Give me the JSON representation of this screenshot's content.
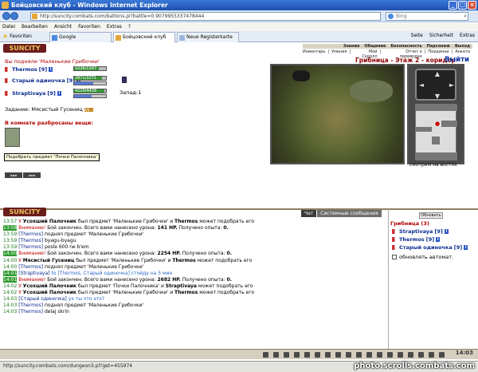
{
  "window": {
    "title": "Бойцовский клуб - Windows Internet Explorer"
  },
  "browser": {
    "url": "http://suncity.combats.com/battons.pl?battle=0.9079955337478444",
    "search_placeholder": "Bing",
    "menu": [
      "Datei",
      "Bearbeiten",
      "Ansicht",
      "Favoriten",
      "Extras",
      "?"
    ],
    "favorites_label": "Favoriten",
    "tabs": [
      {
        "label": "Google"
      },
      {
        "label": "Бойцовский клуб"
      },
      {
        "label": "Neue Registerkarte"
      }
    ],
    "tools": [
      "Seite",
      "Sicherheit",
      "Extras"
    ],
    "status_url": "http://suncity.combats.com/dungeon3.pl?get=455974"
  },
  "game": {
    "logo": "SUNCITY",
    "topnav_row1": [
      "Знания",
      "Общение",
      "Безопасность",
      "Персонаж",
      "Выход"
    ],
    "topnav_row2": [
      "Инвентарь",
      "Умения",
      "Мой Скролл",
      "Отчет о переводах",
      "Поединки",
      "Анкета"
    ],
    "location": "Грибница - Этаж 2 - коридор",
    "exit_label": "Выйти",
    "notice": "Вы подняли 'Маленькие Грибочки'",
    "players": [
      {
        "name": "Thermos",
        "level": "[9]",
        "hp": "1036/1347",
        "hp_frac": 0.77
      },
      {
        "name": "Старый одиночка",
        "level": "[9]",
        "hp": "2871/3271",
        "hp_frac": 0.88
      },
      {
        "name": "Straptivaya",
        "level": "[9]",
        "hp": "4229/4438",
        "hp_frac": 0.95
      }
    ],
    "direction": "Запад-1",
    "task_label": "Задание: Мясистый Гусениц",
    "task_progress": "3/6",
    "scattered_title": "В комнате разбросаны вещи:",
    "tooltip": "Подобрать предмет 'Почки Палочника'",
    "facing": "смотрим на восток",
    "chat_tabs": [
      "Чат",
      "Системные сообщения"
    ],
    "refresh_label": "Обновить",
    "room_title": "Грибница (3)",
    "room_players": [
      {
        "name": "Straptivaya",
        "level": "[9]"
      },
      {
        "name": "Thermos",
        "level": "[9]"
      },
      {
        "name": "Старый одиночка",
        "level": "[9]"
      }
    ],
    "auto_refresh_label": "обновлять автомат.",
    "clock": "14:03",
    "chat": [
      {
        "t": "13:57",
        "hl": false,
        "parts": [
          {
            "c": "warn",
            "x": "У "
          },
          {
            "c": "bold",
            "x": "Усохший Палочник"
          },
          {
            "c": "",
            "x": " был предмет 'Маленькие Грибочки' и "
          },
          {
            "c": "bold",
            "x": "Thermos"
          },
          {
            "c": "",
            "x": " может подобрать его"
          }
        ]
      },
      {
        "t": "13:58",
        "hl": true,
        "parts": [
          {
            "c": "warn",
            "x": "Внимание!"
          },
          {
            "c": "",
            "x": " Бой закончен. Всего вами нанесено урона: "
          },
          {
            "c": "bold",
            "x": "141 HP."
          },
          {
            "c": "",
            "x": " Получено опыта: "
          },
          {
            "c": "bold",
            "x": "0."
          }
        ]
      },
      {
        "t": "13:59",
        "hl": false,
        "parts": [
          {
            "c": "nm",
            "x": "[Thermos]"
          },
          {
            "c": "",
            "x": " поднял предмет 'Маленькие Грибочки'"
          }
        ]
      },
      {
        "t": "13:59",
        "hl": false,
        "parts": [
          {
            "c": "nm",
            "x": "[Thermos]"
          },
          {
            "c": "",
            "x": " byagu-byagu"
          }
        ]
      },
      {
        "t": "13:59",
        "hl": false,
        "parts": [
          {
            "c": "nm",
            "x": "[Thermos]"
          },
          {
            "c": "",
            "x": " posle 600 ne b'em"
          }
        ]
      },
      {
        "t": "14:00",
        "hl": true,
        "parts": [
          {
            "c": "warn",
            "x": "Внимание!"
          },
          {
            "c": "",
            "x": " Бой закончен. Всего вами нанесено урона: "
          },
          {
            "c": "bold",
            "x": "2254 HP."
          },
          {
            "c": "",
            "x": " Получено опыта: "
          },
          {
            "c": "bold",
            "x": "0."
          }
        ]
      },
      {
        "t": "14:00",
        "hl": false,
        "parts": [
          {
            "c": "warn",
            "x": "У "
          },
          {
            "c": "bold",
            "x": "Мясистый Гусениц"
          },
          {
            "c": "",
            "x": " был предмет 'Маленькие Грибочки' и "
          },
          {
            "c": "bold",
            "x": "Thermos"
          },
          {
            "c": "",
            "x": " может подобрать его"
          }
        ]
      },
      {
        "t": "14:00",
        "hl": false,
        "parts": [
          {
            "c": "nm",
            "x": "[Thermos]"
          },
          {
            "c": "",
            "x": " поднял предмет 'Маленькие Грибочки'"
          }
        ]
      },
      {
        "t": "14:01",
        "hl": true,
        "parts": [
          {
            "c": "nm",
            "x": "[Straptivaya]"
          },
          {
            "c": "sys",
            "x": " to [Thermos, Старый одиночка] стойду на 5 мин"
          }
        ]
      },
      {
        "t": "14:01",
        "hl": true,
        "parts": [
          {
            "c": "warn",
            "x": "Внимание!"
          },
          {
            "c": "",
            "x": " Бой закончен. Всего вами нанесено урона: "
          },
          {
            "c": "bold",
            "x": "2682 HP."
          },
          {
            "c": "",
            "x": " Получено опыта: "
          },
          {
            "c": "bold",
            "x": "0."
          }
        ]
      },
      {
        "t": "14:02",
        "hl": false,
        "parts": [
          {
            "c": "warn",
            "x": "У "
          },
          {
            "c": "bold",
            "x": "Усохший Палочник"
          },
          {
            "c": "",
            "x": " был предмет 'Почки Палочника' и "
          },
          {
            "c": "bold",
            "x": "Straptivaya"
          },
          {
            "c": "",
            "x": " может подобрать его"
          }
        ]
      },
      {
        "t": "14:02",
        "hl": false,
        "parts": [
          {
            "c": "warn",
            "x": "У "
          },
          {
            "c": "bold",
            "x": "Усохший Палочник"
          },
          {
            "c": "",
            "x": " был предмет 'Маленькие Грибочки' и "
          },
          {
            "c": "bold",
            "x": "Thermos"
          },
          {
            "c": "",
            "x": " может подобрать его"
          }
        ]
      },
      {
        "t": "14:03",
        "hl": false,
        "parts": [
          {
            "c": "nm",
            "x": "[Старый одиночка]"
          },
          {
            "c": "sys",
            "x": " ух ты что это?"
          }
        ]
      },
      {
        "t": "14:03",
        "hl": false,
        "parts": [
          {
            "c": "nm",
            "x": "[Thermos]"
          },
          {
            "c": "",
            "x": " поднял предмет 'Маленькие Грибочки'"
          }
        ]
      },
      {
        "t": "14:03",
        "hl": false,
        "parts": [
          {
            "c": "nm",
            "x": "[Thermos]"
          },
          {
            "c": "",
            "x": " delaj skrin"
          }
        ]
      }
    ]
  },
  "watermark": "photo.scrolls.combats.com"
}
